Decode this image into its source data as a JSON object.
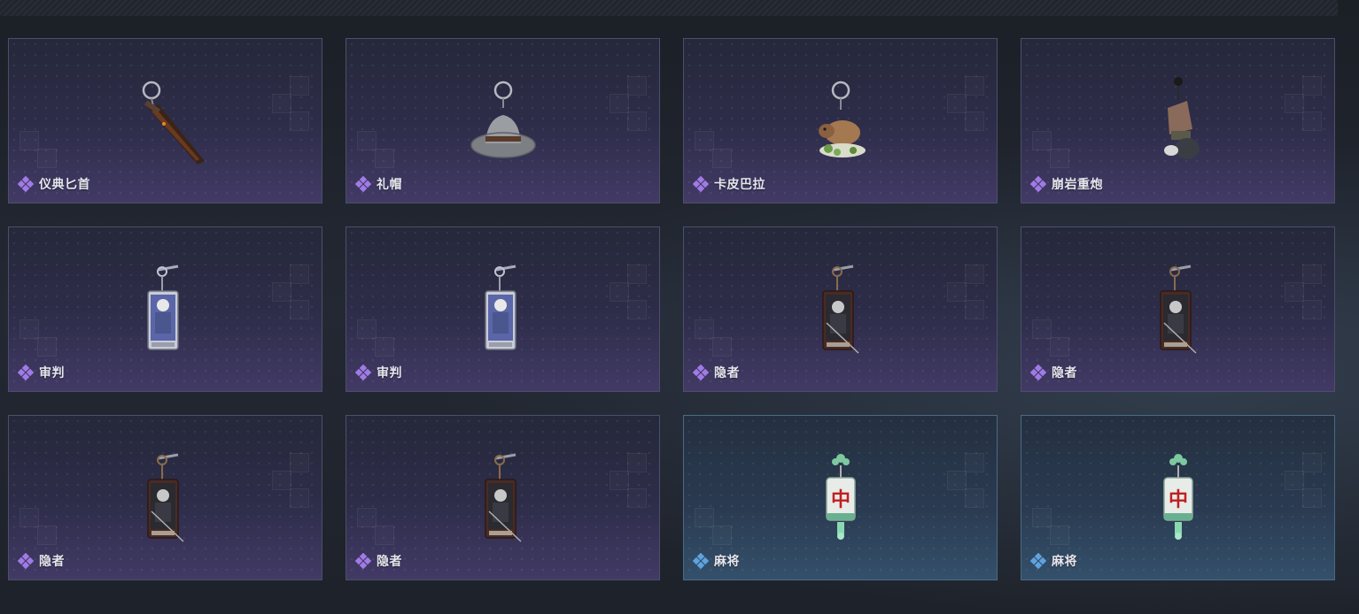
{
  "colors": {
    "rarity_purple": "#a07be6",
    "rarity_blue": "#5ea3e0",
    "card_border_purple": "#4c4f6a",
    "card_border_blue": "#4a6a86"
  },
  "charms": [
    {
      "name": "仪典匕首",
      "rarity": "purple",
      "icon": "ritual-dagger-charm-icon"
    },
    {
      "name": "礼帽",
      "rarity": "purple",
      "icon": "fedora-hat-charm-icon"
    },
    {
      "name": "卡皮巴拉",
      "rarity": "purple",
      "icon": "capybara-charm-icon"
    },
    {
      "name": "崩岩重炮",
      "rarity": "purple",
      "icon": "rock-cannon-charm-icon"
    },
    {
      "name": "审判",
      "rarity": "purple",
      "icon": "judgement-tarot-charm-icon"
    },
    {
      "name": "审判",
      "rarity": "purple",
      "icon": "judgement-tarot-charm-icon"
    },
    {
      "name": "隐者",
      "rarity": "purple",
      "icon": "hermit-tarot-charm-icon"
    },
    {
      "name": "隐者",
      "rarity": "purple",
      "icon": "hermit-tarot-charm-icon"
    },
    {
      "name": "隐者",
      "rarity": "purple",
      "icon": "hermit-tarot-charm-icon"
    },
    {
      "name": "隐者",
      "rarity": "purple",
      "icon": "hermit-tarot-charm-icon"
    },
    {
      "name": "麻将",
      "rarity": "blue",
      "icon": "mahjong-tile-charm-icon",
      "tile_text": "中"
    },
    {
      "name": "麻将",
      "rarity": "blue",
      "icon": "mahjong-tile-charm-icon",
      "tile_text": "中"
    }
  ]
}
